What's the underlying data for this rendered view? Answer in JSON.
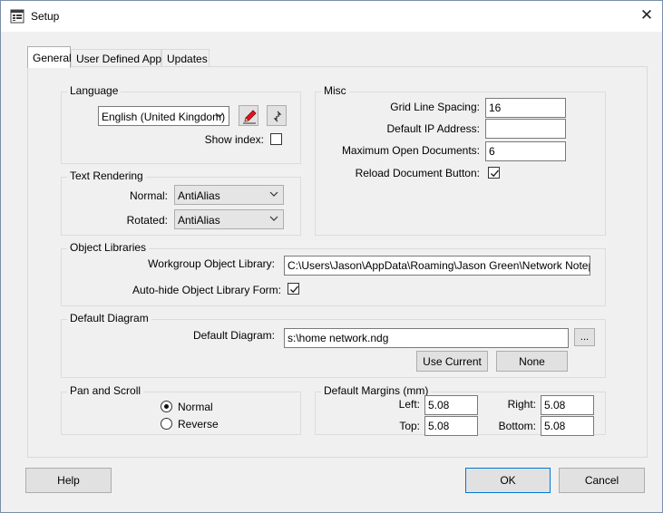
{
  "window": {
    "title": "Setup",
    "close_glyph": "✕"
  },
  "tabs": [
    "General",
    "User Defined Apps",
    "Updates"
  ],
  "language": {
    "group_title": "Language",
    "selected": "English (United Kingdom)",
    "show_index_label": "Show index:",
    "show_index_checked": false
  },
  "misc": {
    "group_title": "Misc",
    "grid_line_spacing_label": "Grid Line Spacing:",
    "grid_line_spacing_value": "16",
    "default_ip_label": "Default IP Address:",
    "default_ip_value": "",
    "max_open_docs_label": "Maximum Open Documents:",
    "max_open_docs_value": "6",
    "reload_doc_label": "Reload Document Button:",
    "reload_doc_checked": true
  },
  "text_rendering": {
    "group_title": "Text Rendering",
    "normal_label": "Normal:",
    "normal_value": "AntiAlias",
    "rotated_label": "Rotated:",
    "rotated_value": "AntiAlias"
  },
  "object_libraries": {
    "group_title": "Object Libraries",
    "workgroup_label": "Workgroup Object Library:",
    "workgroup_value": "C:\\Users\\Jason\\AppData\\Roaming\\Jason Green\\Network Notepad F",
    "autohide_label": "Auto-hide Object Library Form:",
    "autohide_checked": true
  },
  "default_diagram": {
    "group_title": "Default Diagram",
    "label": "Default Diagram:",
    "value": "s:\\home network.ndg",
    "browse_label": "...",
    "use_current_label": "Use Current",
    "none_label": "None"
  },
  "pan_scroll": {
    "group_title": "Pan and Scroll",
    "normal_label": "Normal",
    "reverse_label": "Reverse",
    "selected": "Normal"
  },
  "margins": {
    "group_title": "Default Margins (mm)",
    "left_label": "Left:",
    "left_value": "5.08",
    "right_label": "Right:",
    "right_value": "5.08",
    "top_label": "Top:",
    "top_value": "5.08",
    "bottom_label": "Bottom:",
    "bottom_value": "5.08"
  },
  "footer": {
    "help_label": "Help",
    "ok_label": "OK",
    "cancel_label": "Cancel"
  },
  "colors": {
    "accent": "#0078d7",
    "pencil": "#e81123"
  }
}
